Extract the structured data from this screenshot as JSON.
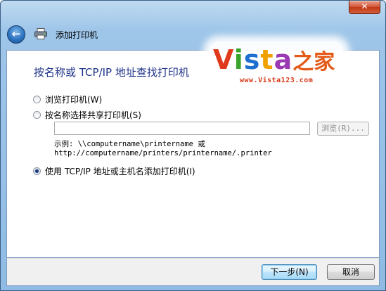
{
  "window": {
    "close_label": "✕"
  },
  "titlebar": {
    "back_glyph": "←",
    "title": "添加打印机"
  },
  "watermark": {
    "logo_letters": [
      "V",
      "i",
      "s",
      "t",
      "a"
    ],
    "logo_cn": "之家",
    "url": "www.Vista123.com"
  },
  "page": {
    "heading": "按名称或 TCP/IP 地址查找打印机",
    "options": [
      {
        "label": "浏览打印机(W)",
        "selected": false
      },
      {
        "label": "按名称选择共享打印机(S)",
        "selected": false
      },
      {
        "label": "使用 TCP/IP 地址或主机名添加打印机(I)",
        "selected": true
      }
    ],
    "share_input": {
      "value": "",
      "placeholder": ""
    },
    "browse_label": "浏览(R)...",
    "example_line1": "示例: \\\\computername\\printername 或",
    "example_line2": "http://computername/printers/printername/.printer"
  },
  "footer": {
    "next_label": "下一步(N)",
    "cancel_label": "取消"
  },
  "colors": {
    "heading": "#1e3287",
    "close_button": "#c23813",
    "frame": "#9fc6e9"
  },
  "icons": {
    "back": "back-arrow-icon",
    "printer": "printer-icon",
    "close": "close-icon"
  }
}
